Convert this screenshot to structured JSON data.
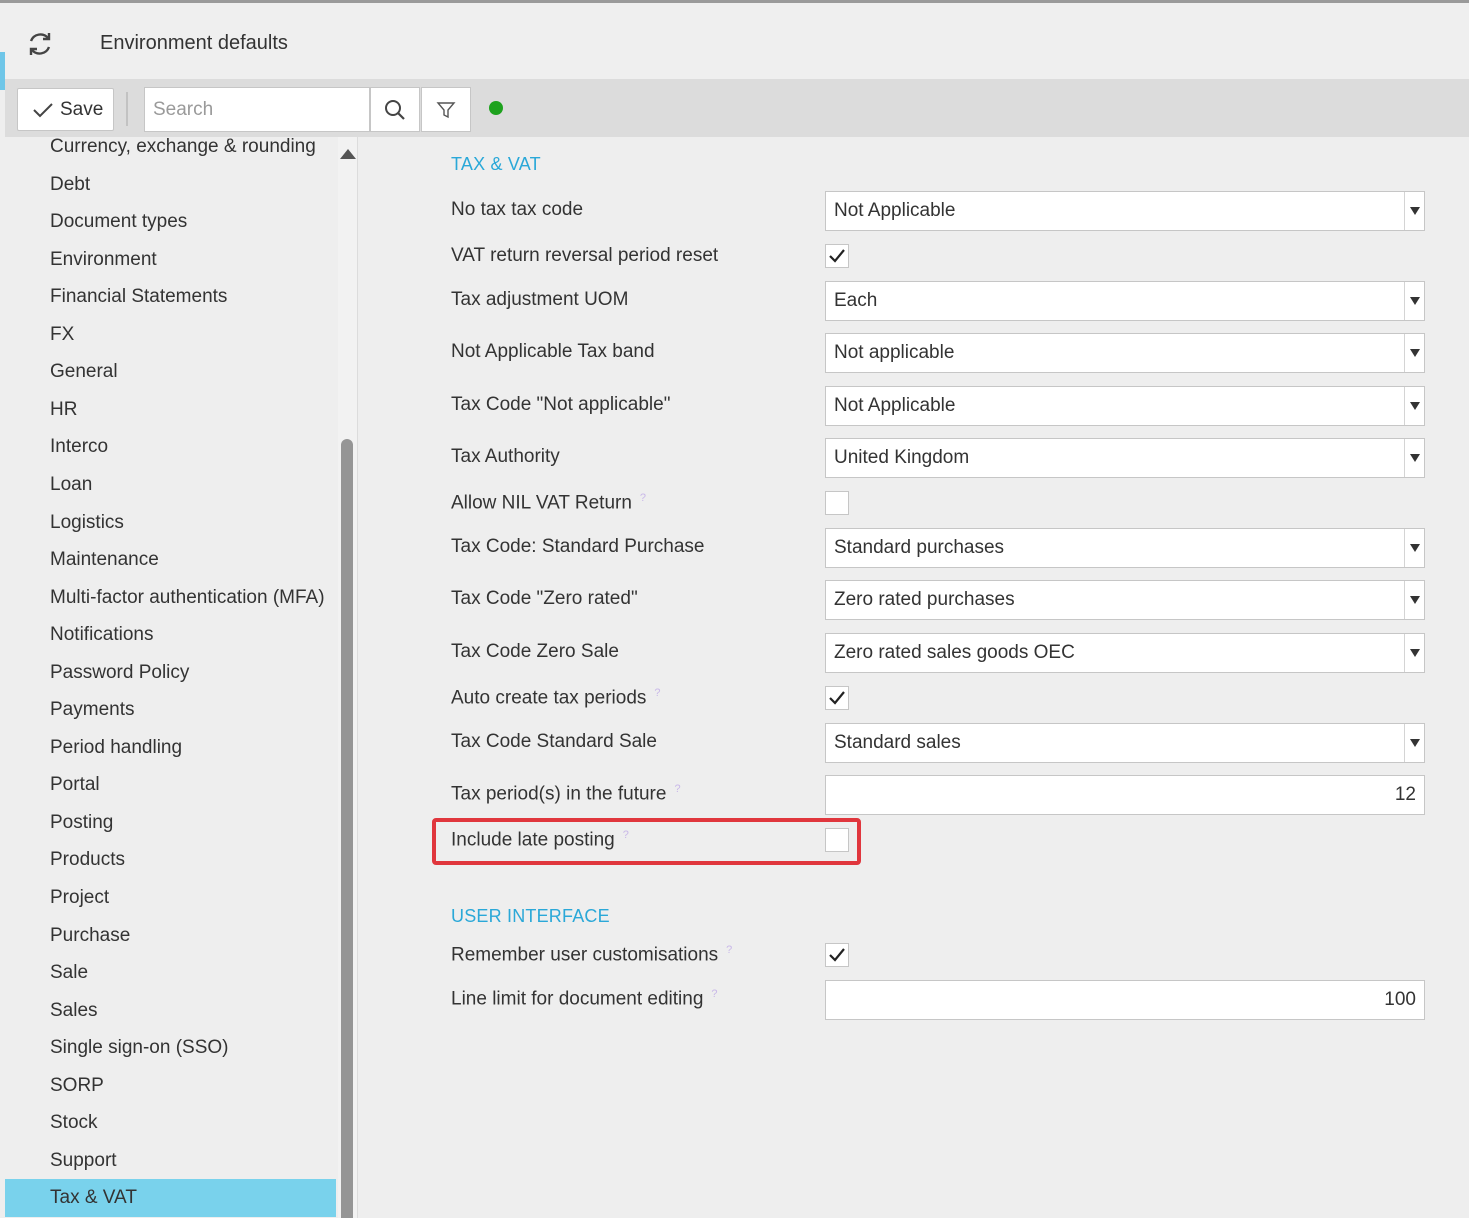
{
  "window": {
    "title": "Environment defaults"
  },
  "toolbar": {
    "save_label": "Save",
    "search_placeholder": "Search"
  },
  "sidebar": {
    "items": [
      "Currency, exchange & rounding",
      "Debt",
      "Document types",
      "Environment",
      "Financial Statements",
      "FX",
      "General",
      "HR",
      "Interco",
      "Loan",
      "Logistics",
      "Maintenance",
      "Multi-factor authentication (MFA)",
      "Notifications",
      "Password Policy",
      "Payments",
      "Period handling",
      "Portal",
      "Posting",
      "Products",
      "Project",
      "Purchase",
      "Sale",
      "Sales",
      "Single sign-on (SSO)",
      "SORP",
      "Stock",
      "Support",
      "Tax & VAT"
    ],
    "active": "Tax & VAT"
  },
  "sections": {
    "tax": {
      "title": "TAX & VAT",
      "rows": [
        {
          "label": "No tax tax code",
          "type": "dropdown",
          "value": "Not Applicable"
        },
        {
          "label": "VAT return reversal period reset",
          "type": "checkbox",
          "checked": true
        },
        {
          "label": "Tax adjustment UOM",
          "type": "dropdown",
          "value": "Each"
        },
        {
          "label": "Not Applicable Tax band",
          "type": "dropdown",
          "value": "Not applicable"
        },
        {
          "label": "Tax Code \"Not applicable\"",
          "type": "dropdown",
          "value": "Not Applicable"
        },
        {
          "label": "Tax Authority",
          "type": "dropdown",
          "value": "United Kingdom"
        },
        {
          "label": "Allow NIL VAT Return",
          "type": "checkbox",
          "checked": false,
          "help": "?"
        },
        {
          "label": "Tax Code: Standard Purchase",
          "type": "dropdown",
          "value": "Standard purchases"
        },
        {
          "label": "Tax Code \"Zero rated\"",
          "type": "dropdown",
          "value": "Zero rated purchases"
        },
        {
          "label": "Tax Code Zero Sale",
          "type": "dropdown",
          "value": "Zero rated sales goods OEC"
        },
        {
          "label": "Auto create tax periods",
          "type": "checkbox",
          "checked": true,
          "help": "?"
        },
        {
          "label": "Tax Code Standard Sale",
          "type": "dropdown",
          "value": "Standard sales"
        },
        {
          "label": "Tax period(s) in the future",
          "type": "number",
          "value": "12",
          "help": "?"
        },
        {
          "label": "Include late posting",
          "type": "checkbox",
          "checked": false,
          "help": "?",
          "highlighted": true
        }
      ]
    },
    "ui": {
      "title": "USER INTERFACE",
      "rows": [
        {
          "label": "Remember user customisations",
          "type": "checkbox",
          "checked": true,
          "help": "?"
        },
        {
          "label": "Line limit for document editing",
          "type": "number",
          "value": "100",
          "help": "?"
        }
      ]
    }
  },
  "colors": {
    "accent": "#79d2ec",
    "section_title": "#2aa8d8",
    "highlight": "#e0363d",
    "status_ok": "#1ea21e"
  },
  "icons": [
    "refresh-icon",
    "checkmark-icon",
    "search-icon",
    "filter-icon",
    "status-indicator"
  ]
}
